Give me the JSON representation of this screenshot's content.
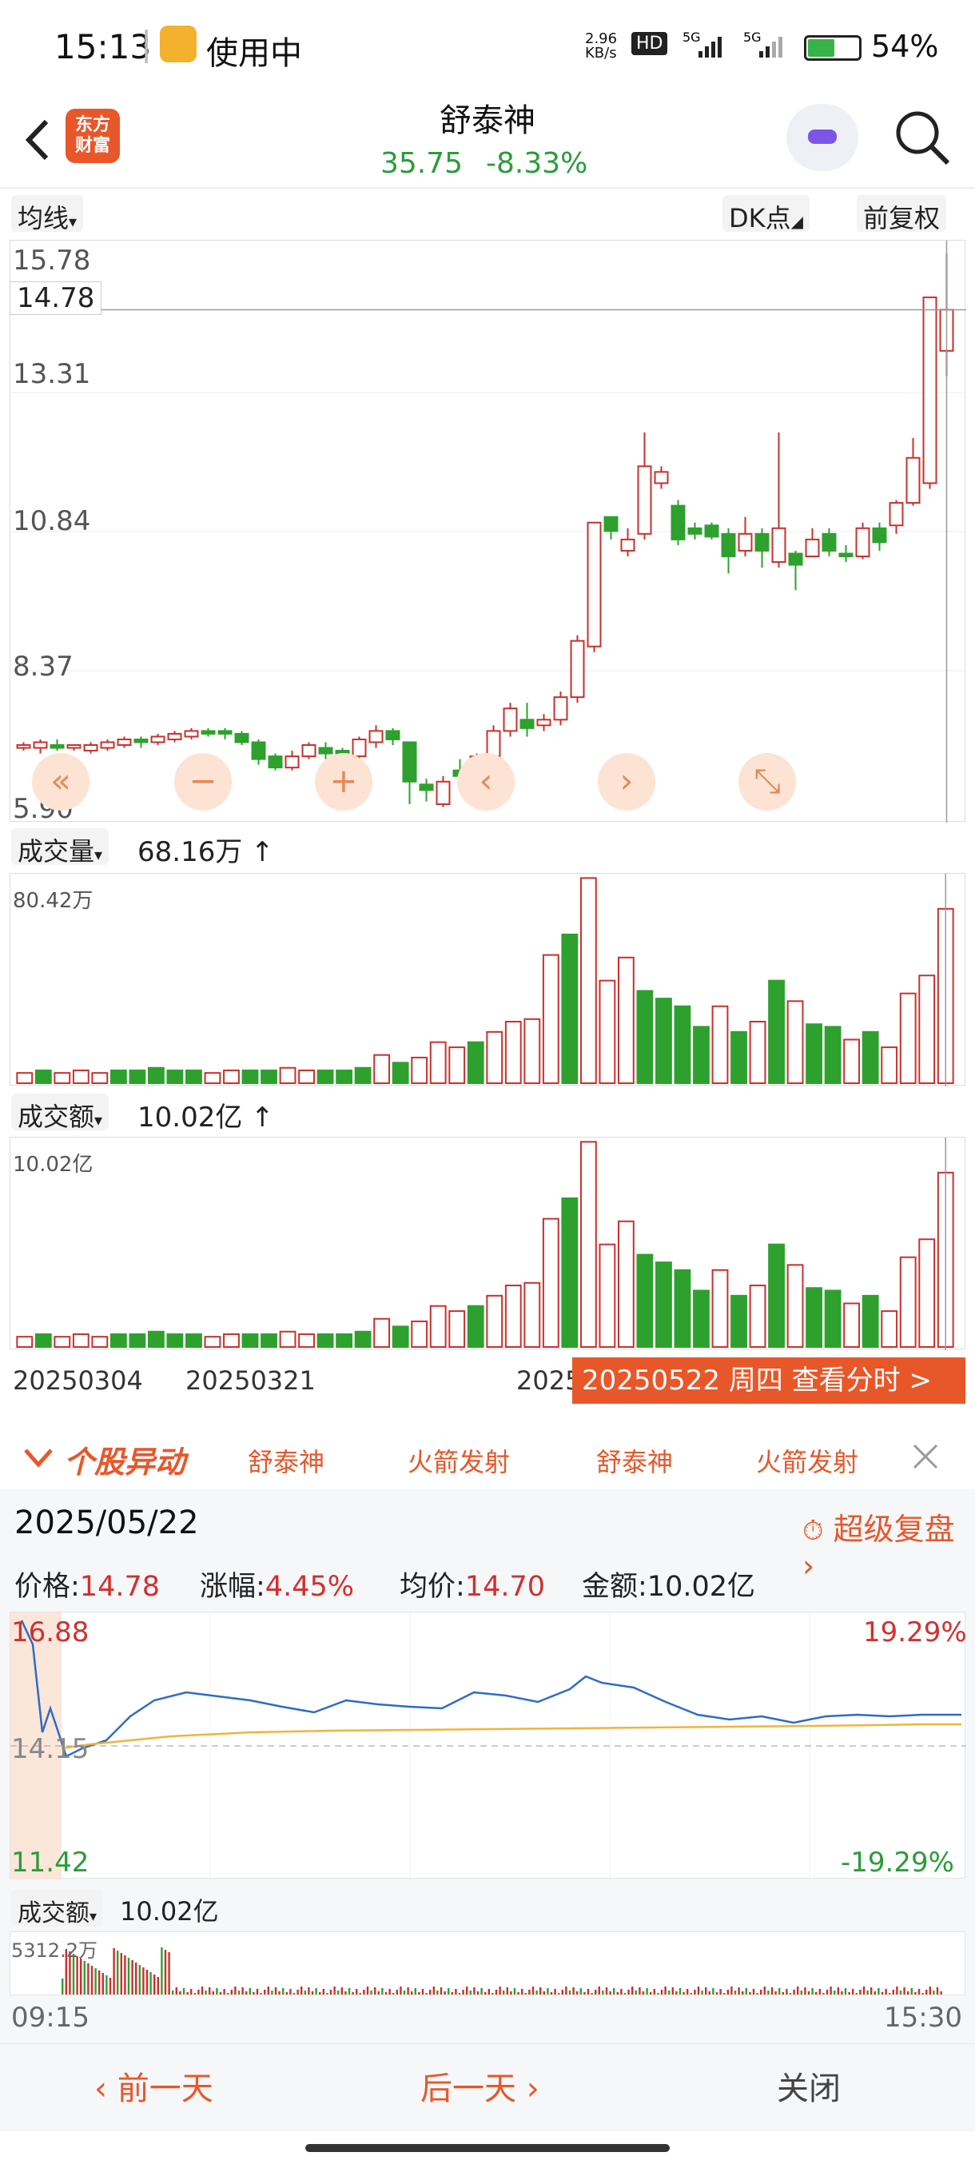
{
  "status_bar": {
    "time": "15:13",
    "in_use": "使用中",
    "net_speed_top": "2.96",
    "net_speed_unit": "KB/s",
    "hd_badge": "HD",
    "sig1": "5G",
    "sig2": "5G",
    "battery": "54%",
    "battery_level": 0.54
  },
  "header": {
    "logo_line1": "东方",
    "logo_line2": "财富",
    "stock_name": "舒泰神",
    "price": "35.75",
    "change_pct": "-8.33%"
  },
  "chart_tools": {
    "ma_chip": "均线",
    "dk_chip": "DK点",
    "adjust_chip": "前复权"
  },
  "kline": {
    "y_labels": [
      "15.78",
      "13.31",
      "10.84",
      "8.37",
      "5.90"
    ],
    "current_label": "14.78",
    "y_range": [
      5.9,
      15.78
    ]
  },
  "volume": {
    "label": "成交量",
    "value": "68.16万",
    "arrow": "↑",
    "max_label": "80.42万"
  },
  "turnover": {
    "label": "成交额",
    "value": "10.02亿",
    "arrow": "↑",
    "max_label": "10.02亿"
  },
  "x_dates": [
    "20250304",
    "20250321",
    "2025"
  ],
  "tooltip_bar": "20250522 周四 查看分时 >",
  "abnormal": {
    "title": "个股异动",
    "items": [
      "舒泰神",
      "火箭发射",
      "舒泰神",
      "火箭发射"
    ]
  },
  "intraday": {
    "date": "2025/05/22",
    "replay": "超级复盘",
    "price_label": "价格:",
    "price": "14.78",
    "change_label": "涨幅:",
    "change": "4.45%",
    "avg_label": "均价:",
    "avg": "14.70",
    "amount_label": "金额:",
    "amount": "10.02亿",
    "top_left": "16.88",
    "mid_left": "14.15",
    "bot_left": "11.42",
    "top_right": "19.29%",
    "bot_right": "-19.29%",
    "vol_chip": "成交额",
    "vol_value": "10.02亿",
    "vol_max": "5312.2万",
    "t_start": "09:15",
    "t_end": "15:30"
  },
  "bottom_nav": {
    "prev": "前一天",
    "next": "后一天",
    "close": "关闭"
  },
  "colors": {
    "up": "#c9302c",
    "down": "#2ea02e",
    "accent": "#e8572a"
  },
  "chart_data": {
    "type": "candlestick",
    "y_range": [
      5.9,
      15.78
    ],
    "candles": [
      [
        7.0,
        7.05,
        6.95,
        7.1,
        1
      ],
      [
        7.0,
        7.1,
        6.9,
        7.15,
        1
      ],
      [
        7.0,
        7.05,
        6.95,
        7.15,
        0
      ],
      [
        7.0,
        7.05,
        6.95,
        7.05,
        1
      ],
      [
        6.95,
        7.05,
        6.9,
        7.1,
        1
      ],
      [
        7.0,
        7.1,
        6.95,
        7.15,
        1
      ],
      [
        7.05,
        7.15,
        7.0,
        7.2,
        1
      ],
      [
        7.1,
        7.15,
        7.0,
        7.2,
        0
      ],
      [
        7.1,
        7.2,
        7.05,
        7.25,
        1
      ],
      [
        7.15,
        7.25,
        7.1,
        7.3,
        1
      ],
      [
        7.2,
        7.3,
        7.15,
        7.35,
        1
      ],
      [
        7.25,
        7.3,
        7.2,
        7.35,
        0
      ],
      [
        7.3,
        7.25,
        7.15,
        7.35,
        0
      ],
      [
        7.25,
        7.1,
        7.05,
        7.3,
        0
      ],
      [
        7.1,
        6.8,
        6.7,
        7.15,
        0
      ],
      [
        6.85,
        6.65,
        6.6,
        6.9,
        0
      ],
      [
        6.65,
        6.85,
        6.6,
        6.95,
        1
      ],
      [
        6.85,
        7.05,
        6.8,
        7.1,
        1
      ],
      [
        7.0,
        6.9,
        6.8,
        7.1,
        0
      ],
      [
        6.95,
        6.85,
        6.75,
        7.0,
        0
      ],
      [
        6.85,
        7.15,
        6.8,
        7.2,
        1
      ],
      [
        7.1,
        7.3,
        7.0,
        7.4,
        1
      ],
      [
        7.3,
        7.15,
        7.05,
        7.35,
        0
      ],
      [
        7.1,
        6.4,
        6.0,
        7.1,
        0
      ],
      [
        6.35,
        6.25,
        6.05,
        6.45,
        0
      ],
      [
        6.0,
        6.4,
        5.95,
        6.5,
        1
      ],
      [
        6.5,
        6.6,
        6.45,
        6.8,
        0
      ],
      [
        6.6,
        6.85,
        6.5,
        6.9,
        1
      ],
      [
        6.85,
        7.3,
        6.8,
        7.4,
        1
      ],
      [
        7.3,
        7.7,
        7.2,
        7.8,
        1
      ],
      [
        7.5,
        7.35,
        7.2,
        7.8,
        0
      ],
      [
        7.4,
        7.5,
        7.3,
        7.6,
        1
      ],
      [
        7.5,
        7.9,
        7.4,
        8.0,
        1
      ],
      [
        7.9,
        8.9,
        7.8,
        9.0,
        1
      ],
      [
        8.8,
        11.0,
        8.7,
        11.0,
        1
      ],
      [
        11.1,
        10.85,
        10.7,
        11.1,
        0
      ],
      [
        10.5,
        10.7,
        10.4,
        10.9,
        1
      ],
      [
        10.8,
        12.0,
        10.7,
        12.6,
        1
      ],
      [
        11.7,
        11.9,
        11.6,
        12.0,
        1
      ],
      [
        11.3,
        10.7,
        10.6,
        11.4,
        0
      ],
      [
        10.9,
        10.8,
        10.7,
        11.0,
        0
      ],
      [
        10.95,
        10.75,
        10.7,
        11.0,
        0
      ],
      [
        10.8,
        10.4,
        10.1,
        10.9,
        0
      ],
      [
        10.5,
        10.8,
        10.4,
        11.1,
        1
      ],
      [
        10.8,
        10.5,
        10.2,
        10.9,
        0
      ],
      [
        10.3,
        10.9,
        10.2,
        12.6,
        1
      ],
      [
        10.45,
        10.25,
        9.8,
        10.5,
        0
      ],
      [
        10.4,
        10.7,
        10.4,
        10.9,
        1
      ],
      [
        10.8,
        10.5,
        10.4,
        10.9,
        0
      ],
      [
        10.45,
        10.4,
        10.3,
        10.6,
        0
      ],
      [
        10.4,
        10.9,
        10.35,
        11.0,
        1
      ],
      [
        10.9,
        10.65,
        10.5,
        11.0,
        0
      ],
      [
        10.95,
        11.35,
        10.8,
        11.4,
        1
      ],
      [
        11.35,
        12.15,
        11.3,
        12.5,
        1
      ],
      [
        11.7,
        15.0,
        11.6,
        15.0,
        1
      ],
      [
        14.05,
        14.78,
        13.6,
        15.78,
        1
      ]
    ],
    "volume_max": 80.42,
    "volumes": [
      4,
      5,
      4,
      5,
      4,
      5,
      5,
      6,
      5,
      5,
      4,
      5,
      5,
      5,
      6,
      5,
      5,
      5,
      6,
      11,
      8,
      10,
      16,
      14,
      16,
      20,
      24,
      25,
      50,
      58,
      80,
      40,
      49,
      36,
      33,
      30,
      22,
      30,
      20,
      24,
      40,
      32,
      23,
      22,
      17,
      20,
      14,
      35,
      42,
      68
    ]
  }
}
